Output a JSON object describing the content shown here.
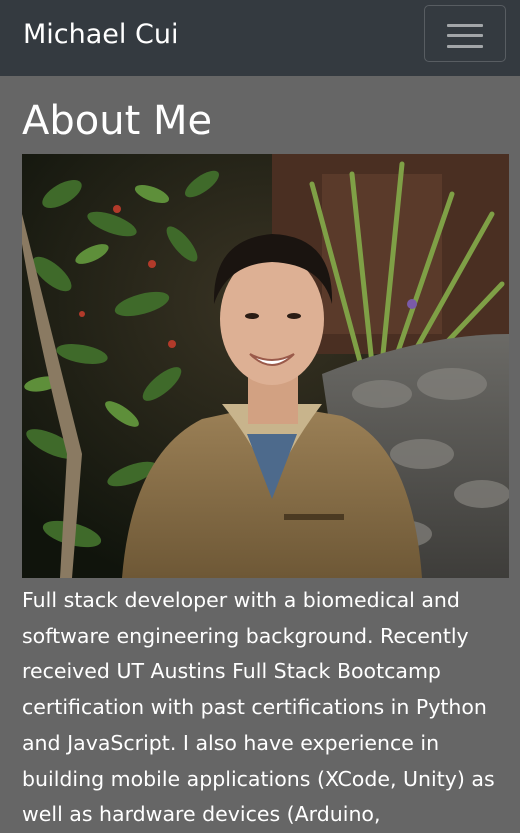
{
  "navbar": {
    "brand": "Michael Cui",
    "toggler_icon": "hamburger-menu-icon"
  },
  "main": {
    "title": "About Me",
    "photo_alt": "Photo of Michael Cui",
    "bio": "Full stack developer with a biomedical and software engineering background. Recently received UT Austins Full Stack Bootcamp certification with past certifications in Python and JavaScript. I also have experience in building mobile applications (XCode, Unity) as well as hardware devices (Arduino,"
  },
  "colors": {
    "navbar_bg": "#343a40",
    "page_bg": "#666666",
    "text": "#ffffff"
  }
}
